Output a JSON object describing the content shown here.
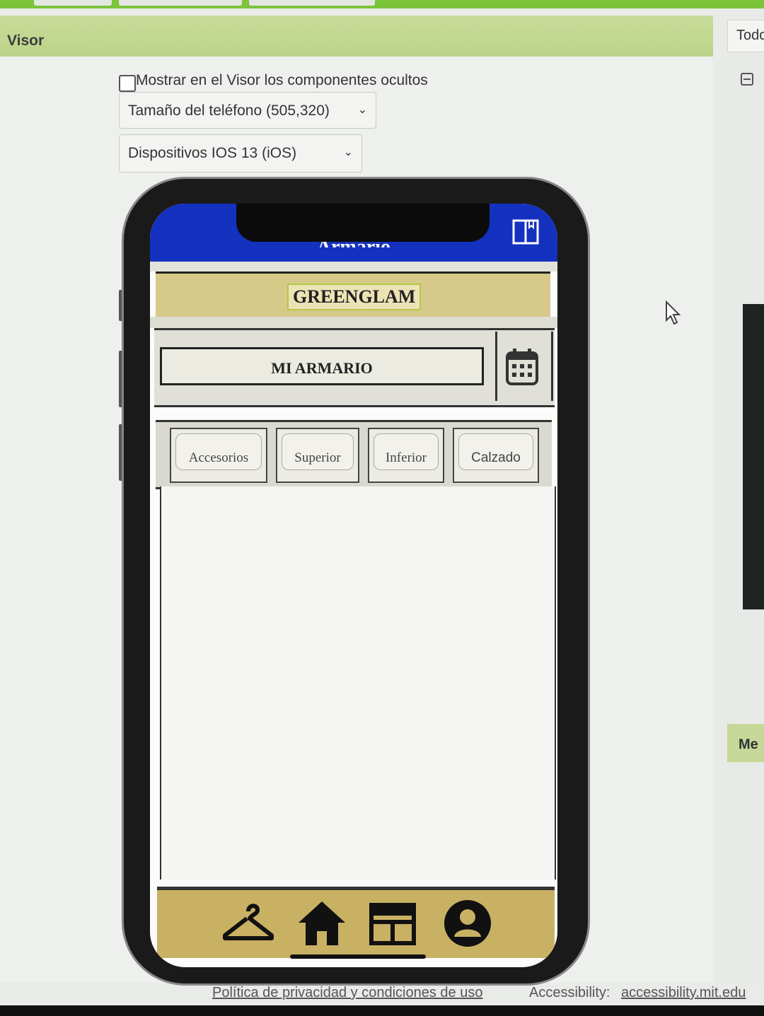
{
  "viewer": {
    "title": "Visor",
    "show_hidden_label": "Mostrar en el Visor los componentes ocultos",
    "phone_size": "Tamaño del teléfono (505,320)",
    "device": "Dispositivos IOS 13 (iOS)"
  },
  "right_panel": {
    "header": "Todo",
    "section": "Me"
  },
  "app": {
    "screen_title": "Armario",
    "brand": "GREENGLAM",
    "armario_button": "MI ARMARIO",
    "tabs": [
      {
        "label": "Accesorios"
      },
      {
        "label": "Superior"
      },
      {
        "label": "Inferior"
      },
      {
        "label": "Calzado"
      }
    ],
    "bottom_nav_icons": [
      "hanger-icon",
      "home-icon",
      "calendar-board-icon",
      "user-icon"
    ],
    "colors": {
      "header_blue": "#1531bf",
      "gold": "#d7c98a",
      "nav_gold": "#c9b163",
      "accent_green": "#7cc43a"
    }
  },
  "footer": {
    "privacy": "Política de privacidad y condiciones de uso",
    "accessibility_label": "Accessibility:",
    "accessibility_link": "accessibility.mit.edu"
  }
}
